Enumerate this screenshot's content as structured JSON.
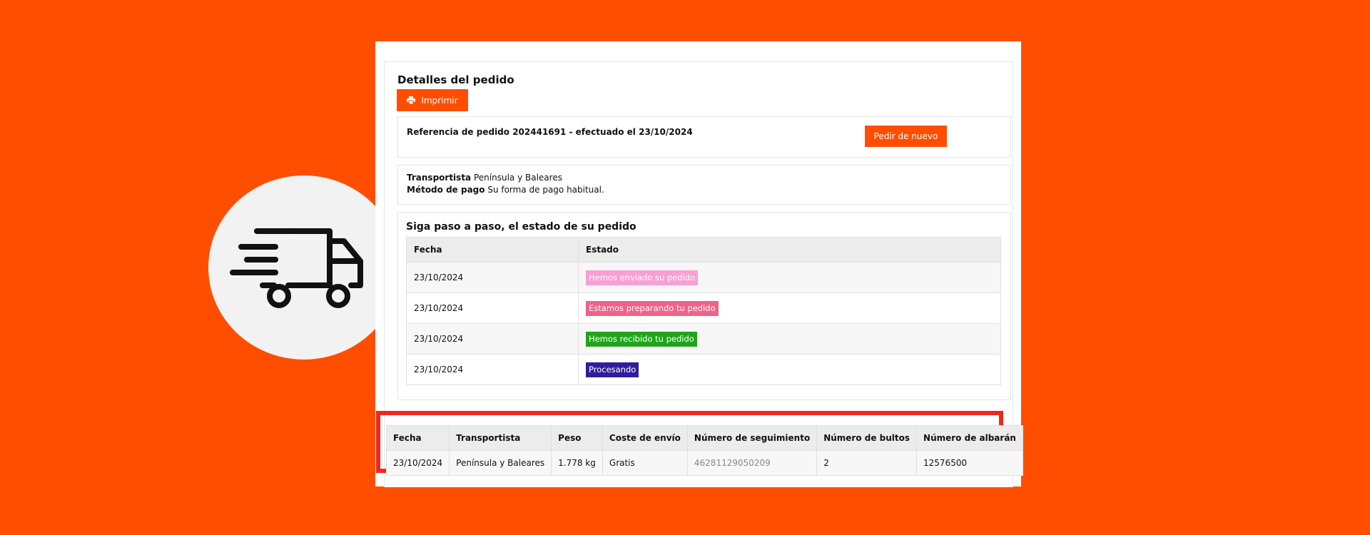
{
  "colors": {
    "background": "#ff4e00",
    "accent": "#ff4e00",
    "highlight_border": "#f3261a"
  },
  "decor": {
    "icon": "delivery-truck-icon"
  },
  "order": {
    "title": "Detalles del pedido",
    "print_label": "Imprimir",
    "reference_text": "Referencia de pedido 202441691 - efectuado el 23/10/2024",
    "reorder_label": "Pedir de nuevo"
  },
  "shipping": {
    "carrier_label": "Transportista",
    "carrier_value": "Península y Baleares",
    "payment_label": "Método de pago",
    "payment_value": "Su forma de pago habitual."
  },
  "status_history": {
    "title": "Siga paso a paso, el estado de su pedido",
    "headers": [
      "Fecha",
      "Estado"
    ],
    "rows": [
      {
        "date": "23/10/2024",
        "status": "Hemos enviado su pedido",
        "color": "#f99fd4"
      },
      {
        "date": "23/10/2024",
        "status": "Estamos preparando tu pedido",
        "color": "#f0628a"
      },
      {
        "date": "23/10/2024",
        "status": "Hemos recibido tu pedido",
        "color": "#1fa51a"
      },
      {
        "date": "23/10/2024",
        "status": "Procesando",
        "color": "#2f1e9b"
      }
    ]
  },
  "tracking": {
    "headers": [
      "Fecha",
      "Transportista",
      "Peso",
      "Coste de envío",
      "Número de seguimiento",
      "Número de bultos",
      "Número de albarán"
    ],
    "row": [
      "23/10/2024",
      "Península y Baleares",
      "1.778 kg",
      "Gratis",
      "46281129050209",
      "2",
      "12576500"
    ]
  }
}
